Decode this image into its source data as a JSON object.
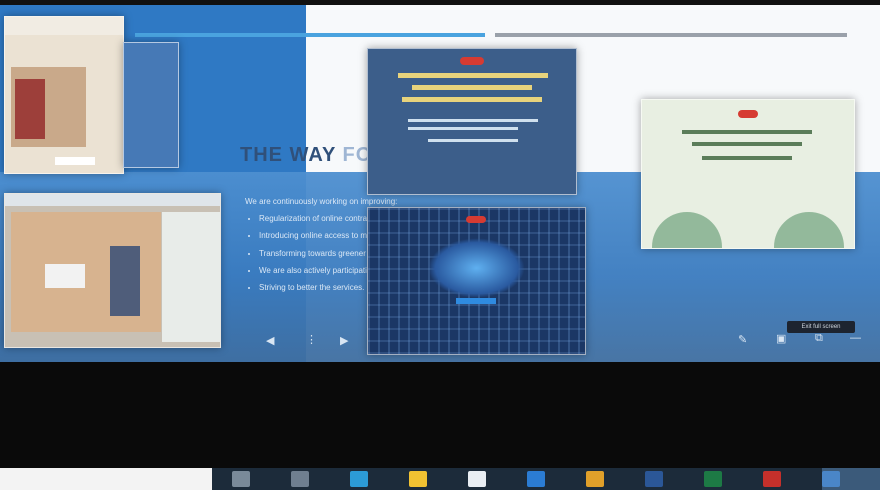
{
  "slide": {
    "title_main": "THE WAY",
    "title_rest": "FORWARD",
    "lead": "We are continuously working on improving:",
    "bullets": [
      "Regularization of online contract works, better working environment for workers",
      "Introducing online access to many services along with digital records",
      "Transforming towards greener energy solutions, planting trees and greener surroundings",
      "We are also actively participating in environmental awareness and welfare activities",
      "Striving to better the services."
    ]
  },
  "controls": {
    "prev_icon": "chevron-left-icon",
    "menu_icon": "more-icon",
    "next_icon": "chevron-right-icon",
    "pen_icon": "pen-icon",
    "screen_icon": "monitor-icon",
    "fullscreen_icon": "expand-icon",
    "tooltip": "Exit full screen"
  },
  "taskbar": {
    "icons": [
      {
        "name": "search-icon",
        "color": "#7a8a99"
      },
      {
        "name": "task-view-icon",
        "color": "#6f7f90"
      },
      {
        "name": "edge-icon",
        "color": "#2c9bd6"
      },
      {
        "name": "file-explorer-icon",
        "color": "#f1c232"
      },
      {
        "name": "store-icon",
        "color": "#e9eef3"
      },
      {
        "name": "mail-icon",
        "color": "#2b7cd3"
      },
      {
        "name": "chrome-icon",
        "color": "#e0a02a"
      },
      {
        "name": "word-icon",
        "color": "#2b5797"
      },
      {
        "name": "excel-icon",
        "color": "#1d7a45"
      },
      {
        "name": "acrobat-icon",
        "color": "#c4302b"
      },
      {
        "name": "powerpoint-active-icon",
        "color": "#4a86c8"
      }
    ]
  }
}
